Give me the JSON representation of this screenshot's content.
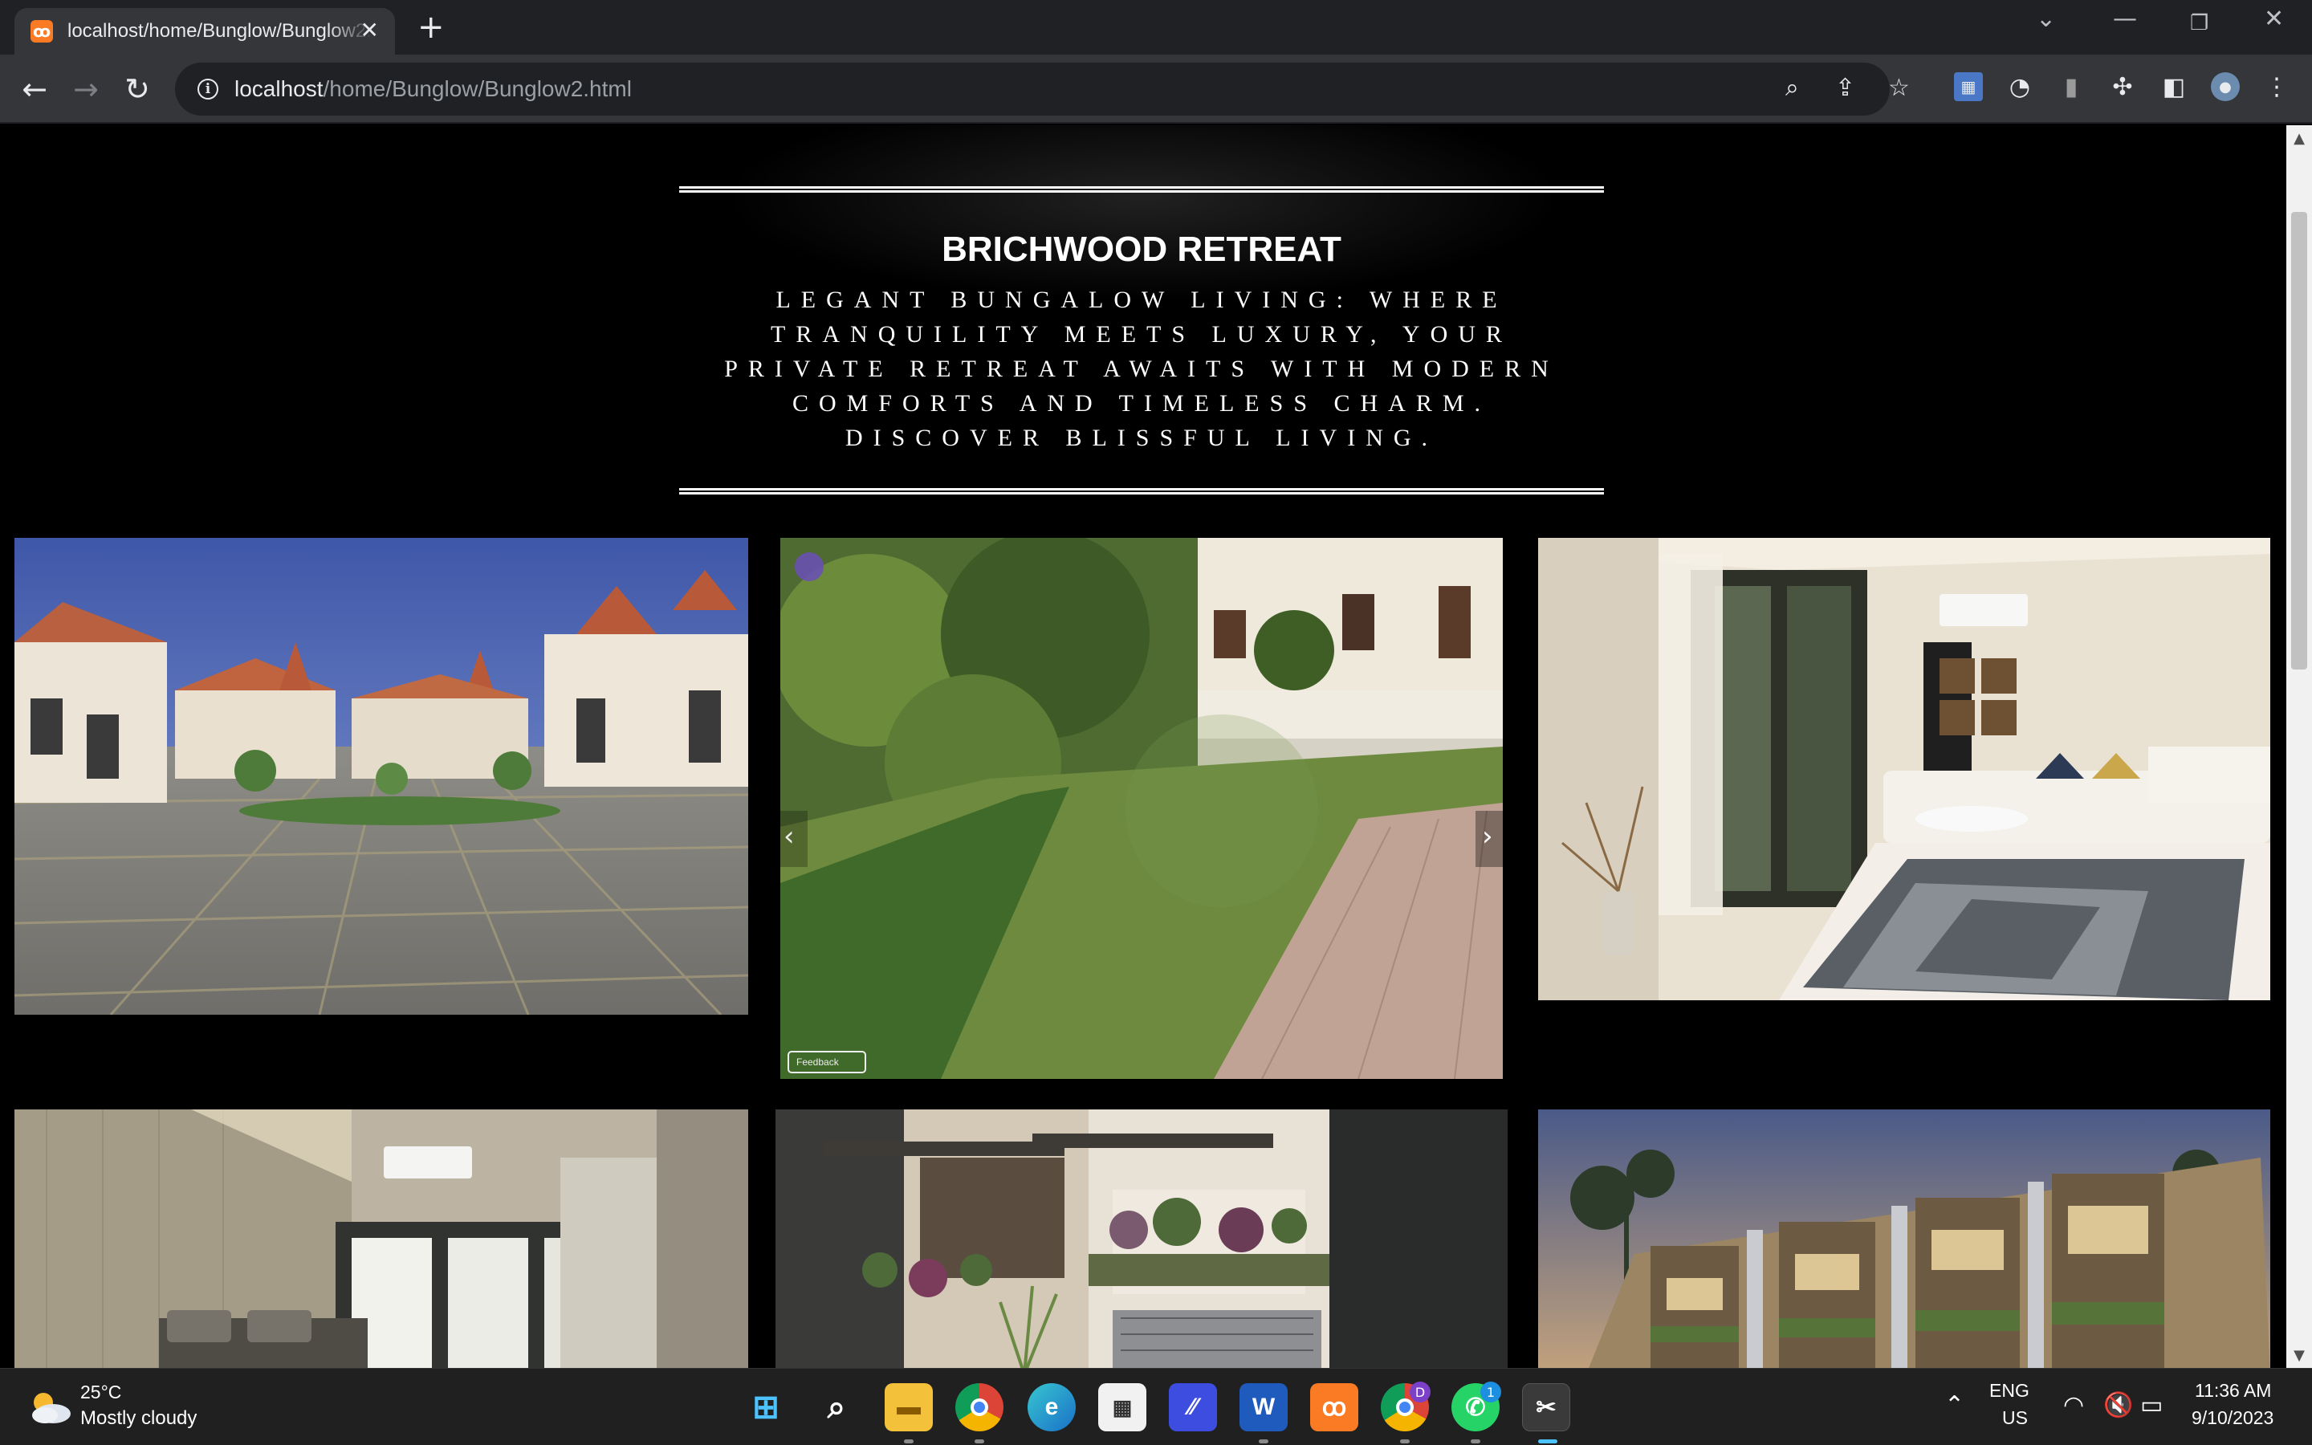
{
  "browser": {
    "tab_title": "localhost/home/Bunglow/Bunglow2.html",
    "tab_favicon": "xampp-icon",
    "url_host": "localhost",
    "url_path": "/home/Bunglow/Bunglow2.html"
  },
  "page": {
    "title": "BRICHWOOD RETREAT",
    "subtitle": "LEGANT BUNGALOW LIVING: WHERE TRANQUILITY MEETS LUXURY, YOUR PRIVATE RETREAT AWAITS WITH MODERN COMFORTS AND TIMELESS CHARM. DISCOVER BLISSFUL LIVING.",
    "gallery_nav_prev": "‹",
    "gallery_nav_next": "›",
    "gallery_feedback": "Feedback"
  },
  "taskbar": {
    "weather_temp": "25°C",
    "weather_desc": "Mostly cloudy",
    "lang_top": "ENG",
    "lang_bottom": "US",
    "time": "11:36 AM",
    "date": "9/10/2023",
    "whatsapp_badge": "1",
    "chrome_profile_badge": "D"
  },
  "colors": {
    "page_background": "#000000",
    "browser_toolbar": "#35363a",
    "tab_strip": "#202124",
    "taskbar": "#202020"
  }
}
